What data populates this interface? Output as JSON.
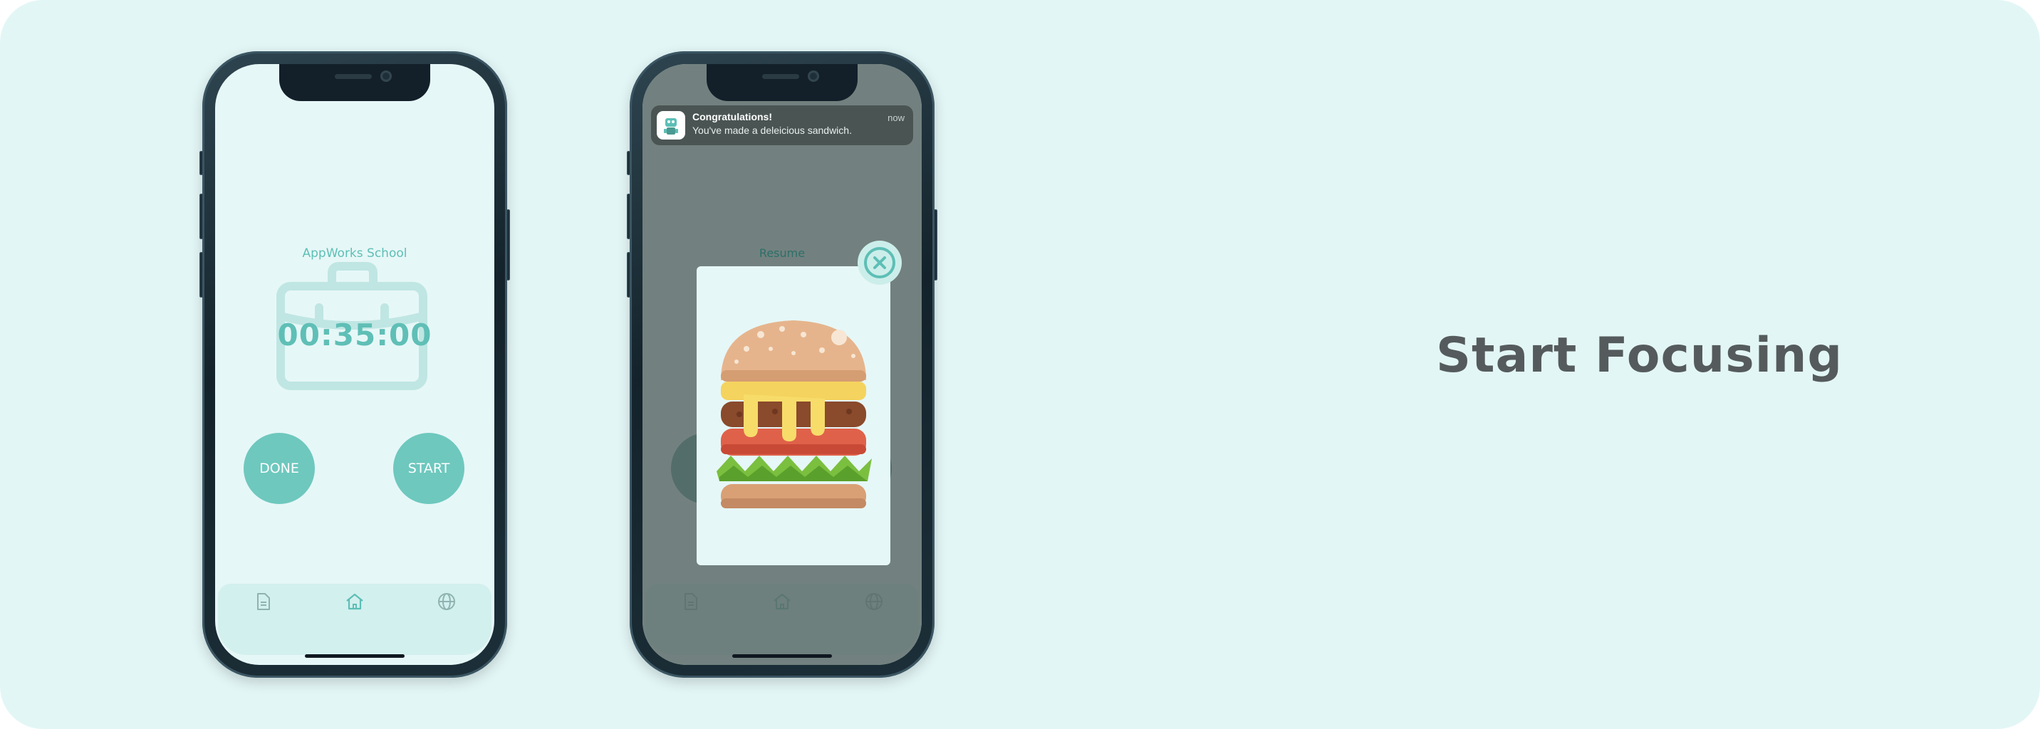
{
  "headline": "Start Focusing",
  "phone1": {
    "school_label": "AppWorks School",
    "timer": "00:35:00",
    "done_label": "DONE",
    "start_label": "START",
    "tabs": [
      {
        "name": "notes",
        "icon": "document-icon"
      },
      {
        "name": "home",
        "icon": "home-icon"
      },
      {
        "name": "world",
        "icon": "globe-icon"
      }
    ]
  },
  "phone2": {
    "resume_label": "Resume",
    "notification": {
      "title": "Congratulations!",
      "body": "You've made a deleicious sandwich.",
      "time": "now"
    },
    "popup_image": "sandwich-illustration"
  },
  "colors": {
    "background": "#e3f6f6",
    "accent": "#6ec8be",
    "headline": "#555b5c",
    "dim_overlay": "#586664"
  }
}
